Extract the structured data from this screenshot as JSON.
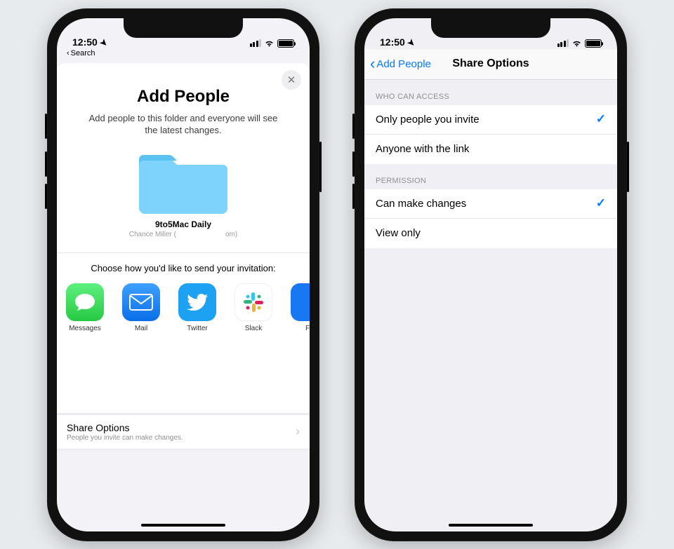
{
  "status": {
    "time": "12:50",
    "search_back": "Search"
  },
  "phone1": {
    "title": "Add People",
    "description": "Add people to this folder and everyone will see the latest changes.",
    "folder_name": "9to5Mac Daily",
    "owner_label": "Chance Miller (",
    "owner_suffix": "om)",
    "invite_label": "Choose how you'd like to send your invitation:",
    "apps": [
      {
        "name": "Messages"
      },
      {
        "name": "Mail"
      },
      {
        "name": "Twitter"
      },
      {
        "name": "Slack"
      },
      {
        "name": "Fa"
      }
    ],
    "share_options": {
      "title": "Share Options",
      "subtitle": "People you invite can make changes."
    }
  },
  "phone2": {
    "back_label": "Add People",
    "title": "Share Options",
    "sections": [
      {
        "header": "WHO CAN ACCESS",
        "rows": [
          {
            "label": "Only people you invite",
            "checked": true
          },
          {
            "label": "Anyone with the link",
            "checked": false
          }
        ]
      },
      {
        "header": "PERMISSION",
        "rows": [
          {
            "label": "Can make changes",
            "checked": true
          },
          {
            "label": "View only",
            "checked": false
          }
        ]
      }
    ]
  }
}
